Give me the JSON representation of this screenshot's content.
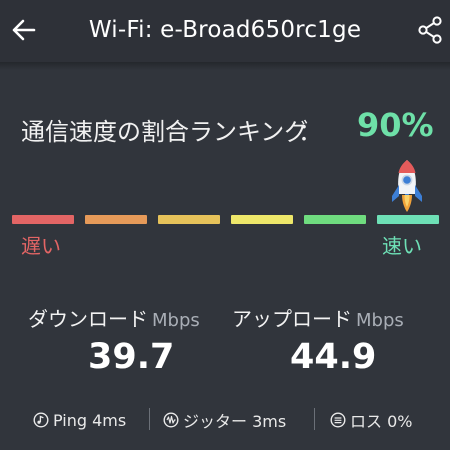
{
  "header": {
    "title": "Wi-Fi: e-Broad650rc1ge",
    "back_icon": "arrow-left-icon",
    "share_icon": "share-icon"
  },
  "ranking": {
    "label": "通信速度の割合ランキング",
    "colon": "：",
    "value": "90%",
    "level_fraction": 0.9,
    "slow_label": "遅い",
    "fast_label": "速い",
    "indicator_icon": "rocket-icon",
    "segment_colors": [
      "#e36565",
      "#e69a59",
      "#e6c25a",
      "#eee76a",
      "#6fdc7f",
      "#6ee0b6"
    ],
    "slow_color": "#e36565",
    "fast_color": "#6ee0b6"
  },
  "stats": {
    "download": {
      "label": "ダウンロード",
      "unit": "Mbps",
      "value": "39.7"
    },
    "upload": {
      "label": "アップロード",
      "unit": "Mbps",
      "value": "44.9"
    }
  },
  "footer": {
    "ping": "Ping 4ms",
    "jitter": "ジッター 3ms",
    "loss": "ロス 0%"
  }
}
